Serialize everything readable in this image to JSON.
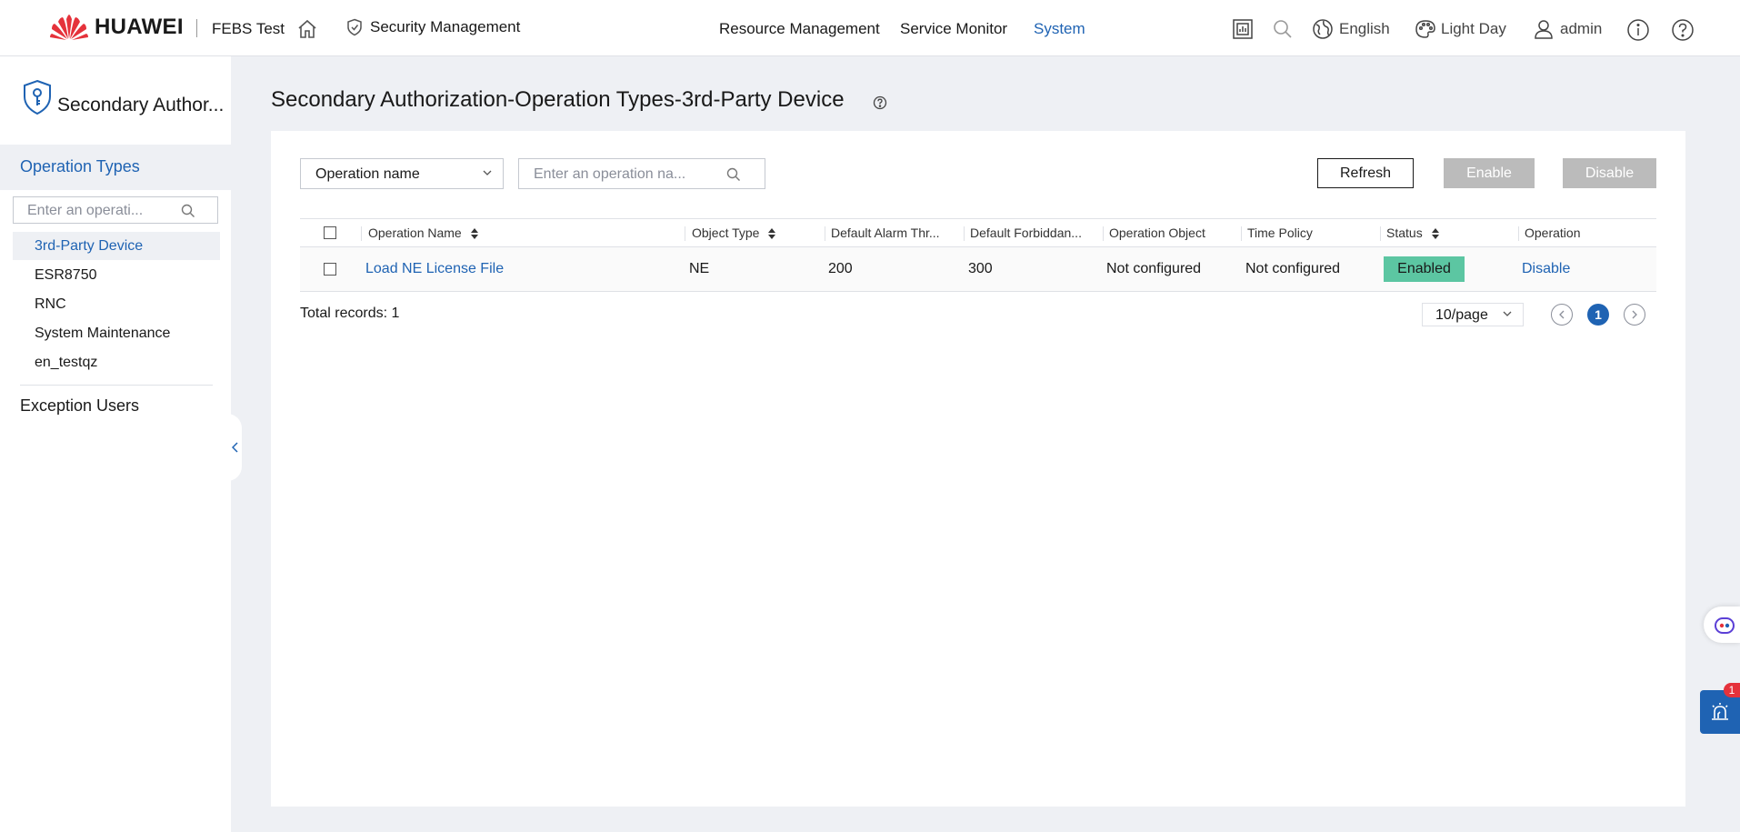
{
  "header": {
    "brand": "HUAWEI",
    "project": "FEBS Test",
    "module": "Security Management",
    "nav": [
      "Resource Management",
      "Service Monitor",
      "System"
    ],
    "active_nav": "System",
    "language": "English",
    "theme": "Light Day",
    "user": "admin"
  },
  "sidebar": {
    "title": "Secondary Author...",
    "section": "Operation Types",
    "search_placeholder": "Enter an operati...",
    "items": [
      {
        "label": "3rd-Party Device",
        "active": true
      },
      {
        "label": "ESR8750"
      },
      {
        "label": "RNC"
      },
      {
        "label": "System Maintenance"
      },
      {
        "label": "en_testqz"
      }
    ],
    "exception_users": "Exception Users"
  },
  "main": {
    "title": "Secondary Authorization-Operation Types-3rd-Party Device",
    "filter_value": "Operation name",
    "search_placeholder": "Enter an operation na...",
    "buttons": {
      "refresh": "Refresh",
      "enable": "Enable",
      "disable": "Disable"
    },
    "columns": [
      "Operation Name",
      "Object Type",
      "Default Alarm Thr...",
      "Default Forbiddan...",
      "Operation Object",
      "Time Policy",
      "Status",
      "Operation"
    ],
    "rows": [
      {
        "operation_name": "Load NE License File",
        "object_type": "NE",
        "alarm_threshold": "200",
        "forbidden_threshold": "300",
        "operation_object": "Not configured",
        "time_policy": "Not configured",
        "status": "Enabled",
        "action": "Disable"
      }
    ],
    "total": "Total records: 1",
    "page_size": "10/page",
    "current_page": "1"
  },
  "floating": {
    "alarm_count": "1"
  },
  "colors": {
    "accent": "#1f63b3",
    "enabled": "#5cc6a2",
    "disabled_button": "#bbbbbb",
    "brand_red": "#e5323b"
  }
}
